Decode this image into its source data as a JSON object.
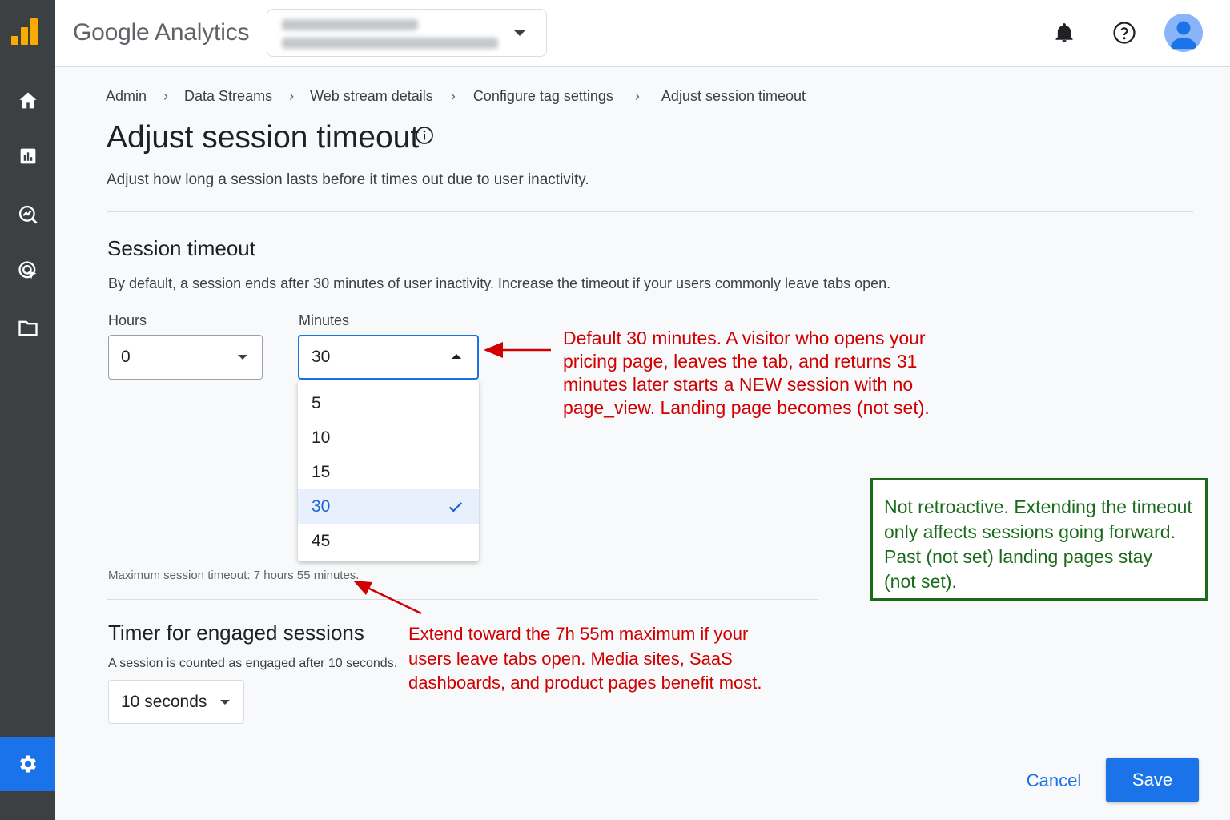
{
  "app": {
    "brand": "Google Analytics"
  },
  "colors": {
    "accent": "#1a73e8",
    "rail": "#3c4043",
    "logo": "#f9ab00",
    "annotation_red": "#d00000",
    "annotation_green": "#1b6b1b"
  },
  "rail": {
    "icons": [
      "analytics-logo-icon",
      "home-icon",
      "reports-icon",
      "explore-icon",
      "advertising-icon",
      "folder-icon",
      "admin-gear-icon"
    ],
    "active": "admin-gear-icon"
  },
  "topbar": {
    "account_selector": {
      "line1": "",
      "line2": "",
      "note": "blurred"
    },
    "icons": [
      "notifications-bell-icon",
      "help-icon",
      "account-avatar-icon"
    ]
  },
  "breadcrumb": {
    "items": [
      "Admin",
      "Data Streams",
      "Web stream details",
      "Configure tag settings",
      "Adjust session timeout"
    ],
    "separator": "›"
  },
  "page": {
    "title": "Adjust session timeout",
    "subtitle": "Adjust how long a session lasts before it times out due to user inactivity."
  },
  "session_timeout": {
    "heading": "Session timeout",
    "description": "By default, a session ends after 30 minutes of user inactivity. Increase the timeout if your users commonly leave tabs open.",
    "hours_label": "Hours",
    "hours_value": "0",
    "minutes_label": "Minutes",
    "minutes_value": "30",
    "minutes_options": [
      "5",
      "10",
      "15",
      "30",
      "45"
    ],
    "minutes_selected": "30",
    "max_note": "Maximum session timeout: 7 hours 55 minutes."
  },
  "engaged": {
    "heading": "Timer for engaged sessions",
    "description": "A session is counted as engaged after 10 seconds.",
    "value": "10 seconds"
  },
  "annotations": {
    "red_top": [
      "Default 30 minutes. A visitor who opens your",
      "pricing page, leaves the tab, and returns 31",
      "minutes later starts a NEW session with no",
      "page_view. Landing page becomes (not set)."
    ],
    "red_bottom": [
      "Extend toward the 7h 55m maximum if your",
      "users leave tabs open. Media sites, SaaS",
      "dashboards, and product pages benefit most."
    ],
    "green_box": [
      "Not retroactive. Extending the timeout",
      "only affects sessions going forward.",
      "Past (not set) landing pages stay",
      "(not set)."
    ]
  },
  "footer": {
    "cancel_label": "Cancel",
    "save_label": "Save"
  }
}
